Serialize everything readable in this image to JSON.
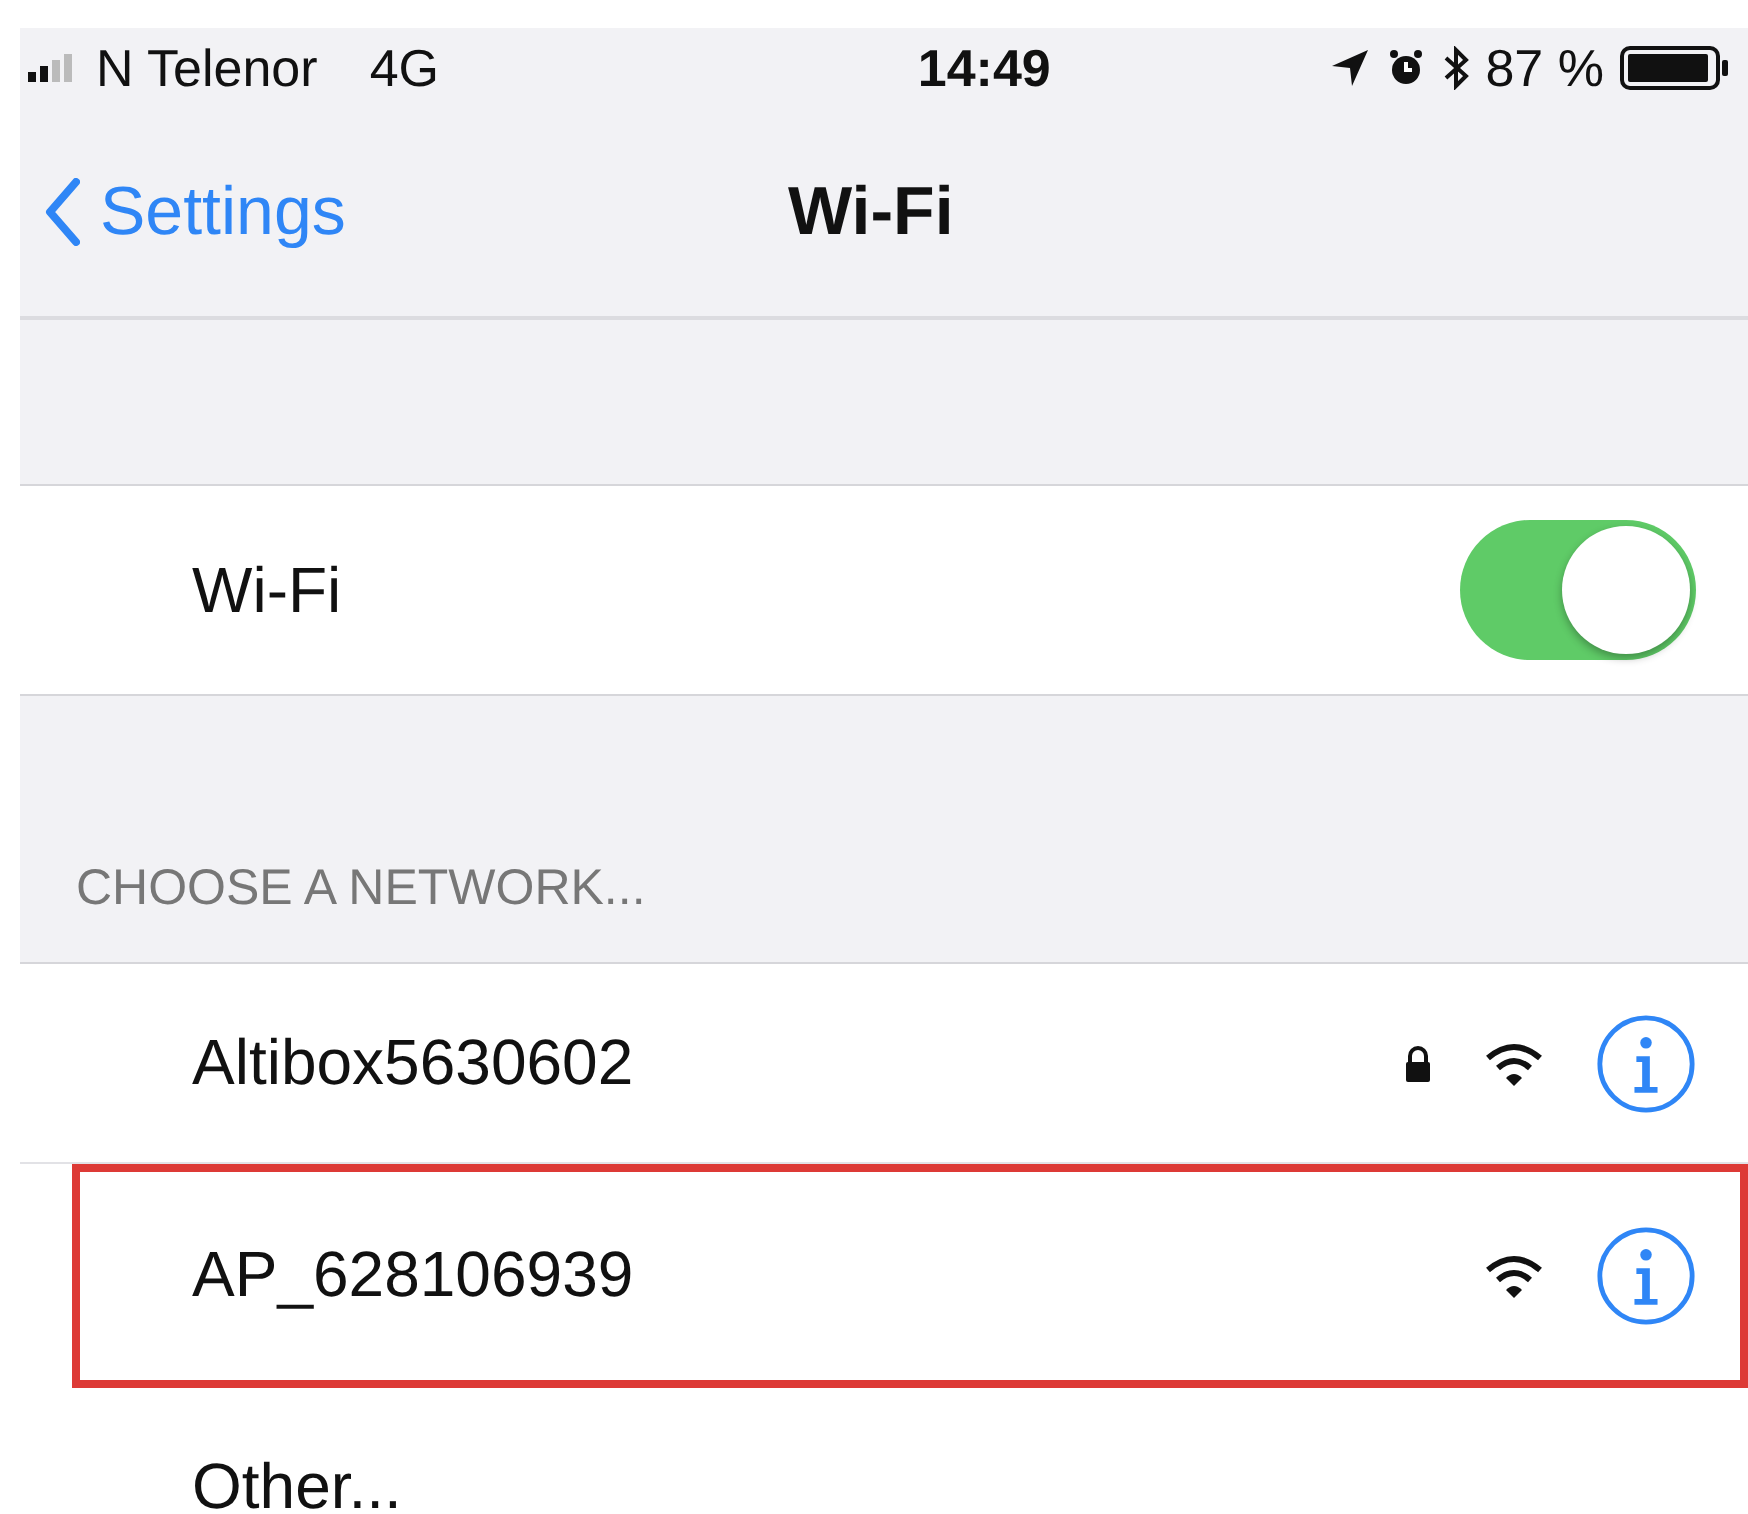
{
  "status_bar": {
    "carrier": "N Telenor",
    "network": "4G",
    "time": "14:49",
    "battery": "87 %"
  },
  "nav": {
    "back": "Settings",
    "title": "Wi-Fi"
  },
  "wifi": {
    "label": "Wi-Fi",
    "on": true
  },
  "section_header": "CHOOSE A NETWORK...",
  "networks": [
    {
      "name": "Altibox5630602",
      "locked": true,
      "highlighted": false
    },
    {
      "name": "AP_628106939",
      "locked": false,
      "highlighted": true
    }
  ],
  "other": "Other..."
}
